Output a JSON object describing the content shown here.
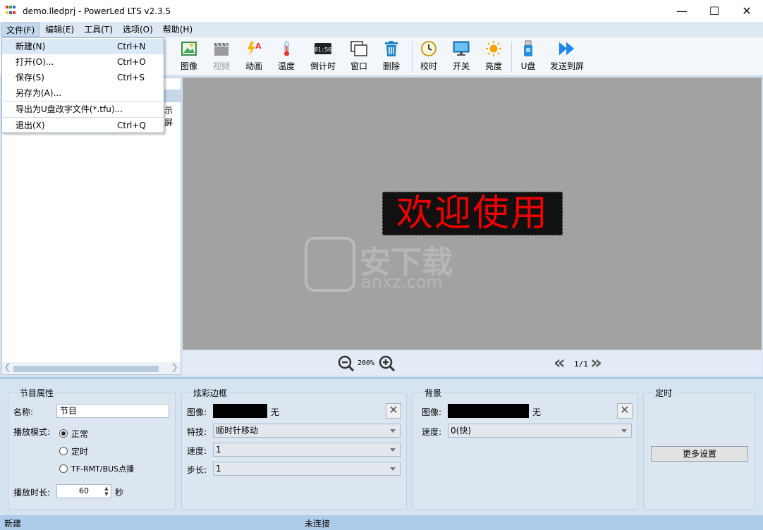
{
  "window": {
    "title": "demo.lledprj - PowerLed LTS v2.3.5",
    "minimize": "—",
    "maximize": "☐",
    "close": "✕"
  },
  "menubar": [
    "文件(F)",
    "编辑(E)",
    "工具(T)",
    "选项(O)",
    "帮助(H)"
  ],
  "file_menu": {
    "items": [
      {
        "label": "新建(N)",
        "shortcut": "Ctrl+N"
      },
      {
        "label": "打开(O)...",
        "shortcut": "Ctrl+O"
      },
      {
        "label": "保存(S)",
        "shortcut": "Ctrl+S"
      },
      {
        "label": "另存为(A)...",
        "shortcut": ""
      },
      {
        "label": "导出为U盘改字文件(*.tfu)...",
        "shortcut": ""
      },
      {
        "label": "退出(X)",
        "shortcut": "Ctrl+Q"
      }
    ]
  },
  "toolbar": [
    {
      "label": "图像",
      "icon": "image-icon",
      "enabled": true
    },
    {
      "label": "视频",
      "icon": "video-clapper-icon",
      "enabled": false
    },
    {
      "label": "动画",
      "icon": "animation-icon",
      "enabled": true
    },
    {
      "label": "温度",
      "icon": "thermometer-icon",
      "enabled": true
    },
    {
      "label": "倒计时",
      "icon": "countdown-icon",
      "enabled": true
    },
    {
      "label": "窗口",
      "icon": "window-icon",
      "enabled": true
    },
    {
      "label": "删除",
      "icon": "trash-icon",
      "enabled": true
    },
    {
      "label": "校时",
      "icon": "clock-icon",
      "enabled": true
    },
    {
      "label": "开关",
      "icon": "monitor-icon",
      "enabled": true
    },
    {
      "label": "亮度",
      "icon": "sun-icon",
      "enabled": true
    },
    {
      "label": "U盘",
      "icon": "usb-drive-icon",
      "enabled": true
    },
    {
      "label": "发送到屏",
      "icon": "send-icon",
      "enabled": true
    }
  ],
  "tree": {
    "partial_text": "示屏"
  },
  "preview": {
    "led_text": "欢迎使用",
    "watermark_cn": "安下载",
    "watermark_en": "anxz.com",
    "zoom": "200%",
    "page": "1/1"
  },
  "program_props": {
    "title": "节目属性",
    "name_label": "名称:",
    "name_value": "节目",
    "mode_label": "播放模式:",
    "modes": [
      "正常",
      "定时",
      "TF-RMT/BUS点播"
    ],
    "selected_mode": 0,
    "duration_label": "播放时长:",
    "duration_value": "60",
    "duration_unit": "秒"
  },
  "border": {
    "title": "炫彩边框",
    "image_label": "图像:",
    "image_value": "无",
    "effect_label": "特技:",
    "effect_value": "顺时针移动",
    "speed_label": "速度:",
    "speed_value": "1",
    "step_label": "步长:",
    "step_value": "1"
  },
  "background": {
    "title": "背景",
    "image_label": "图像:",
    "image_value": "无",
    "speed_label": "速度:",
    "speed_value": "0(快)"
  },
  "timer": {
    "title": "定时",
    "more_button": "更多设置"
  },
  "status": {
    "left": "新建",
    "connection": "未连接"
  },
  "colors": {
    "led_text": "#e00000",
    "status_bar": "#aecbea",
    "preview_bg": "#a2a2a2"
  }
}
